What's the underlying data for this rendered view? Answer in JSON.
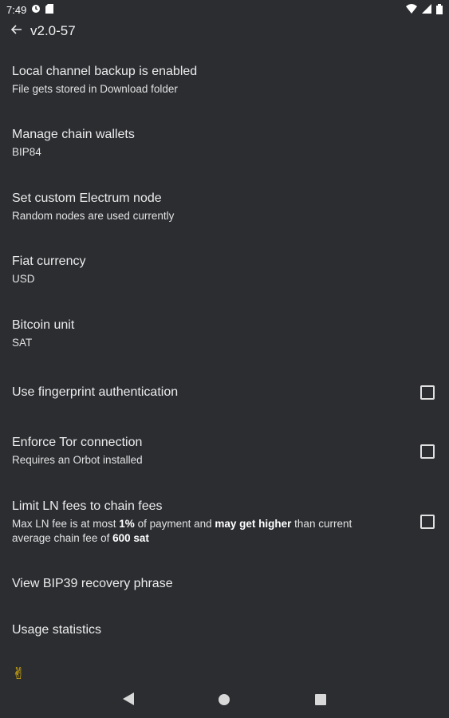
{
  "status_bar": {
    "time": "7:49",
    "left_icons": [
      "sync-icon",
      "sd-card-icon"
    ],
    "right_icons": [
      "wifi-icon",
      "signal-icon",
      "battery-icon"
    ]
  },
  "app_bar": {
    "title": "v2.0-57",
    "back_icon": "arrow-left-icon"
  },
  "settings": [
    {
      "title": "Local channel backup is enabled",
      "subtitle": "File gets stored in Download folder"
    },
    {
      "title": "Manage chain wallets",
      "subtitle": "BIP84"
    },
    {
      "title": "Set custom Electrum node",
      "subtitle": "Random nodes are used currently"
    },
    {
      "title": "Fiat currency",
      "subtitle": "USD"
    },
    {
      "title": "Bitcoin unit",
      "subtitle": "SAT"
    },
    {
      "title": "Use fingerprint authentication",
      "checked": false
    },
    {
      "title": "Enforce Tor connection",
      "subtitle": "Requires an Orbot installed",
      "checked": false
    },
    {
      "title": "Limit LN fees to chain fees",
      "subtitle_parts": [
        "Max LN fee is at most ",
        "1%",
        " of payment and ",
        "may get higher",
        " than current average chain fee of ",
        "600 sat"
      ],
      "checked": false
    },
    {
      "title": "View BIP39 recovery phrase"
    },
    {
      "title": "Usage statistics"
    }
  ],
  "footer": {
    "emoji": "✌"
  },
  "nav_bar": {
    "buttons": [
      "back-triangle-icon",
      "home-circle-icon",
      "recents-square-icon"
    ]
  },
  "colors": {
    "background": "#2b2d31",
    "text": "#e8e8e8",
    "emoji": "#f2c100"
  }
}
